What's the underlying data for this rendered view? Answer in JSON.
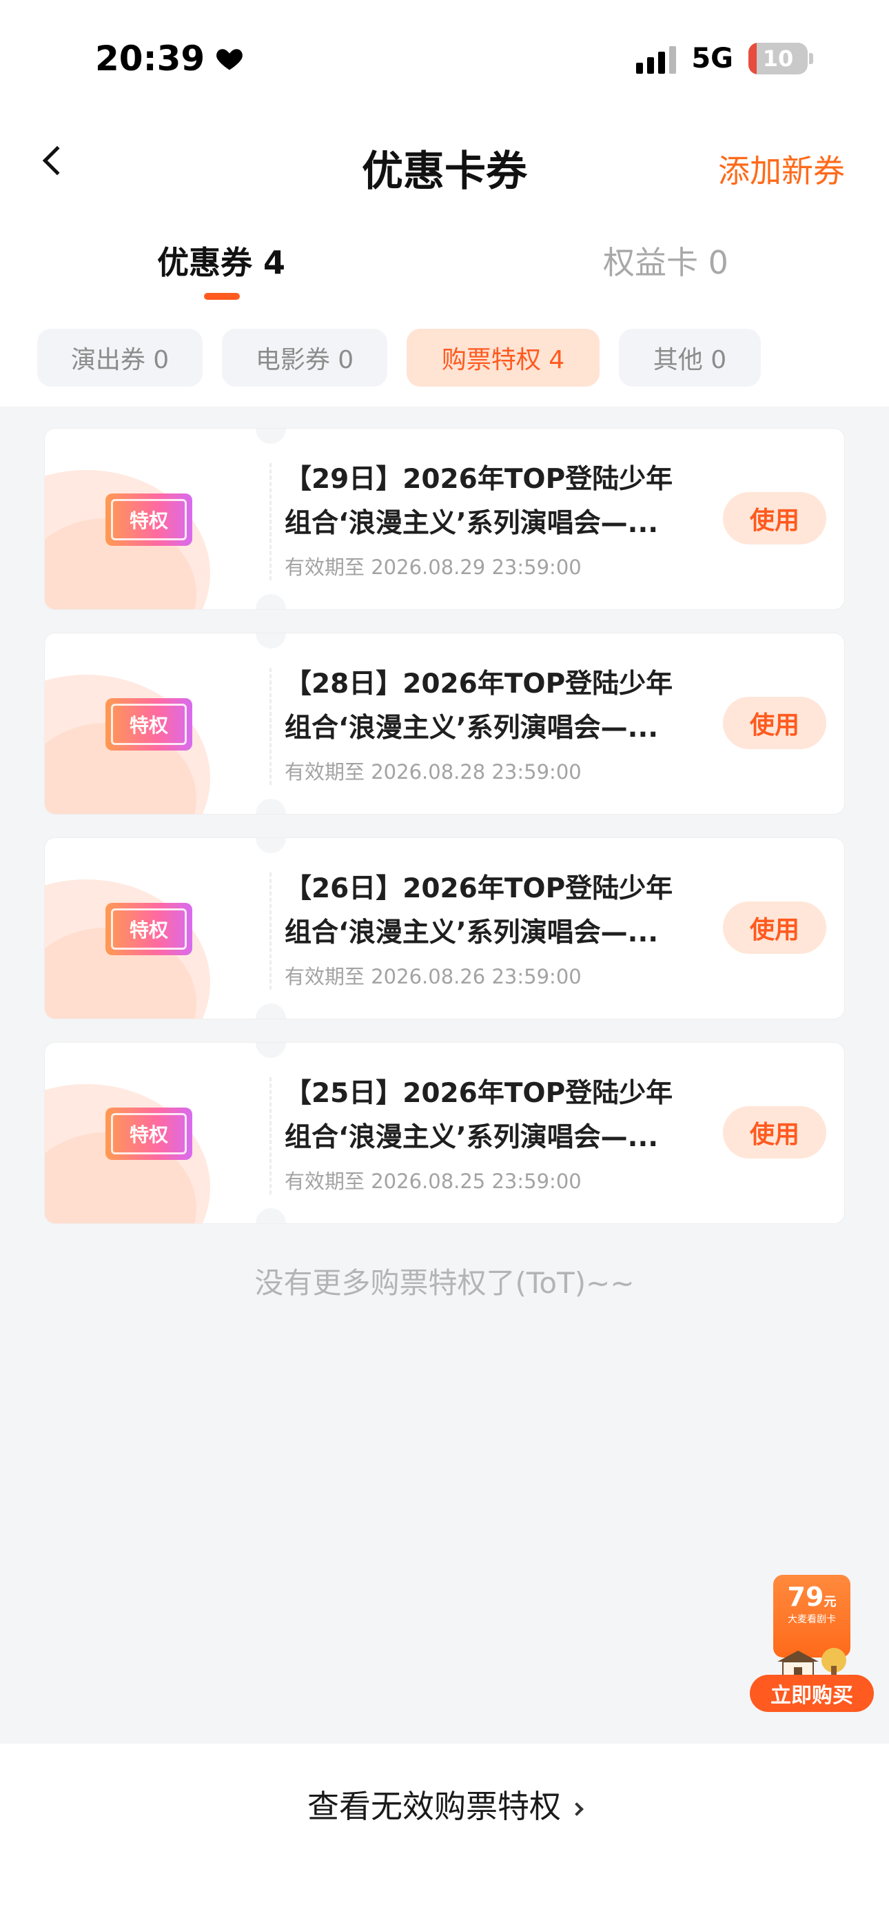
{
  "status_bar": {
    "time": "20:39",
    "network": "5G",
    "battery": "10"
  },
  "header": {
    "title": "优惠卡券",
    "add_label": "添加新券"
  },
  "tabs": [
    {
      "label": "优惠券 4"
    },
    {
      "label": "权益卡 0"
    }
  ],
  "chips": [
    {
      "label": "演出券 0"
    },
    {
      "label": "电影券 0"
    },
    {
      "label": "购票特权 4"
    },
    {
      "label": "其他 0"
    }
  ],
  "coupons": [
    {
      "badge": "特权",
      "title_line1": "【29日】2026年TOP登陆少年",
      "title_line2": "组合‘浪漫主义’系列演唱会—...",
      "date": "有效期至 2026.08.29 23:59:00",
      "action": "使用"
    },
    {
      "badge": "特权",
      "title_line1": "【28日】2026年TOP登陆少年",
      "title_line2": "组合‘浪漫主义’系列演唱会—...",
      "date": "有效期至 2026.08.28 23:59:00",
      "action": "使用"
    },
    {
      "badge": "特权",
      "title_line1": "【26日】2026年TOP登陆少年",
      "title_line2": "组合‘浪漫主义’系列演唱会—...",
      "date": "有效期至 2026.08.26 23:59:00",
      "action": "使用"
    },
    {
      "badge": "特权",
      "title_line1": "【25日】2026年TOP登陆少年",
      "title_line2": "组合‘浪漫主义’系列演唱会—...",
      "date": "有效期至 2026.08.25 23:59:00",
      "action": "使用"
    }
  ],
  "empty_hint": "没有更多购票特权了(ToT)~~",
  "promo": {
    "price": "79",
    "unit": "元",
    "sub": "大麦看剧卡",
    "button": "立即购买"
  },
  "footer": {
    "invalid_link": "查看无效购票特权"
  },
  "colors": {
    "accent": "#ff5a1f",
    "accent_light": "#ffe6d8",
    "background": "#f4f5f7"
  }
}
